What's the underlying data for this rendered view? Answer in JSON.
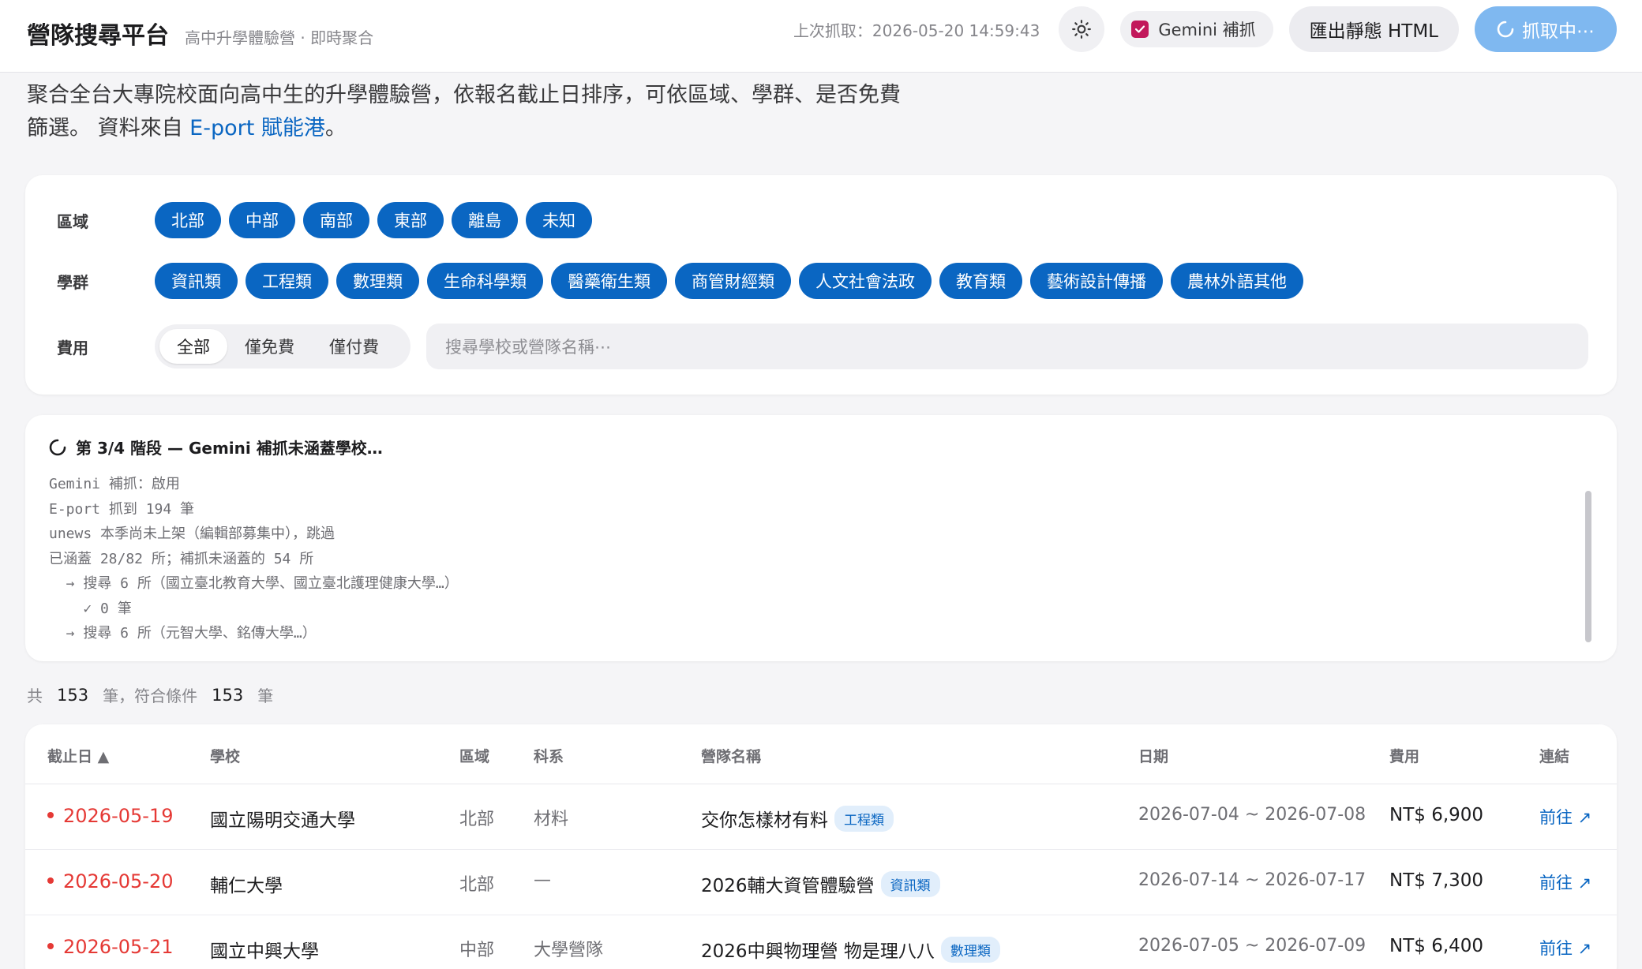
{
  "header": {
    "title": "營隊搜尋平台",
    "subtitle": "高中升學體驗營 · 即時聚合",
    "last_fetch": "上次抓取：2026-05-20 14:59:43",
    "gemini_label": "Gemini 補抓",
    "gemini_checked": true,
    "export_label": "匯出靜態 HTML",
    "fetch_label": "抓取中⋯",
    "theme_icon": "sun-icon"
  },
  "intro": {
    "line1": "聚合全台大專院校面向高中生的升學體驗營，依報名截止日排序，可依區域、學群、是否免費",
    "line2_prefix": "篩選。 資料來自 ",
    "source_link": "E-port 賦能港",
    "line2_suffix": "。"
  },
  "filters": {
    "region_label": "區域",
    "regions": [
      "北部",
      "中部",
      "南部",
      "東部",
      "離島",
      "未知"
    ],
    "group_label": "學群",
    "groups": [
      "資訊類",
      "工程類",
      "數理類",
      "生命科學類",
      "醫藥衛生類",
      "商管財經類",
      "人文社會法政",
      "教育類",
      "藝術設計傳播",
      "農林外語其他"
    ],
    "fee_label": "費用",
    "fee_options": [
      "全部",
      "僅免費",
      "僅付費"
    ],
    "fee_selected": "全部",
    "search_placeholder": "搜尋學校或營隊名稱⋯"
  },
  "progress": {
    "heading": "第 3/4 階段 — Gemini 補抓未涵蓋學校…",
    "lines": [
      "Gemini 補抓：啟用",
      "E-port 抓到 194 筆",
      "unews 本季尚未上架（編輯部募集中），跳過",
      "已涵蓋 28/82 所；補抓未涵蓋的 54 所",
      "  → 搜尋 6 所（國立臺北教育大學、國立臺北護理健康大學…）",
      "    ✓ 0 筆",
      "  → 搜尋 6 所（元智大學、銘傳大學…）"
    ]
  },
  "count": {
    "prefix": "共",
    "total": "153",
    "middle": "筆，符合條件",
    "matched": "153",
    "suffix": "筆"
  },
  "table": {
    "columns": [
      "截止日 ▲",
      "學校",
      "區域",
      "科系",
      "營隊名稱",
      "日期",
      "費用",
      "連結"
    ],
    "rows": [
      {
        "deadline": "2026-05-19",
        "school": "國立陽明交通大學",
        "region": "北部",
        "dept": "材料",
        "camp": "交你怎樣材有料",
        "tag": "工程類",
        "dates": "2026-07-04 ~ 2026-07-08",
        "fee": "NT$ 6,900",
        "link": "前往 ↗"
      },
      {
        "deadline": "2026-05-20",
        "school": "輔仁大學",
        "region": "北部",
        "dept": "—",
        "camp": "2026輔大資管體驗營",
        "tag": "資訊類",
        "dates": "2026-07-14 ~ 2026-07-17",
        "fee": "NT$ 7,300",
        "link": "前往 ↗"
      },
      {
        "deadline": "2026-05-21",
        "school": "國立中興大學",
        "region": "中部",
        "dept": "大學營隊",
        "camp": "2026中興物理營 物是理八八",
        "tag": "數理類",
        "dates": "2026-07-05 ~ 2026-07-09",
        "fee": "NT$ 6,400",
        "link": "前往 ↗"
      }
    ]
  },
  "colors": {
    "accent": "#0a66c2",
    "deadline_red": "#e53935",
    "fetch_button": "#7fb8f0",
    "checkbox": "#c2185b"
  }
}
